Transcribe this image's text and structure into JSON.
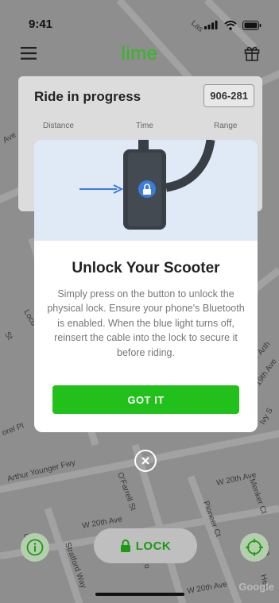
{
  "status_bar": {
    "time": "9:41"
  },
  "header": {
    "logo": "lime"
  },
  "ride_card": {
    "title": "Ride in progress",
    "ride_id": "906-281",
    "stats": [
      "Distance",
      "Time",
      "Range"
    ]
  },
  "modal": {
    "title": "Unlock Your Scooter",
    "body": "Simply press on the button to unlock the physical lock. Ensure your phone's Bluetooth is enabled. When the blue light turns off, reinsert the cable into the lock to secure it before riding.",
    "button": "GOT IT"
  },
  "bottom": {
    "lock_label": "LOCK"
  },
  "map": {
    "streets": [
      "Arthur Younger Fwy",
      "O'Farrell St",
      "Pioneer Ct",
      "W 20th Ave",
      "W 20th Ave",
      "Stratford Way",
      "Menker Ct",
      "W 20th Ave",
      "J. Arth",
      "19th Ave",
      "Ivy S",
      "Locu",
      "St",
      "orel Pl",
      "Ave",
      "Las",
      "Hea",
      "ugh St",
      "Ave",
      "ro"
    ],
    "attribution": "Google"
  },
  "colors": {
    "brand_green": "#22c01a",
    "illustration_bg": "#dfeaf6",
    "arrow_blue": "#3b7ddd"
  },
  "icons": [
    "menu-icon",
    "gift-icon",
    "signal-icon",
    "wifi-icon",
    "battery-icon",
    "lock-icon",
    "arrow-icon",
    "close-icon",
    "info-icon",
    "locate-icon"
  ]
}
